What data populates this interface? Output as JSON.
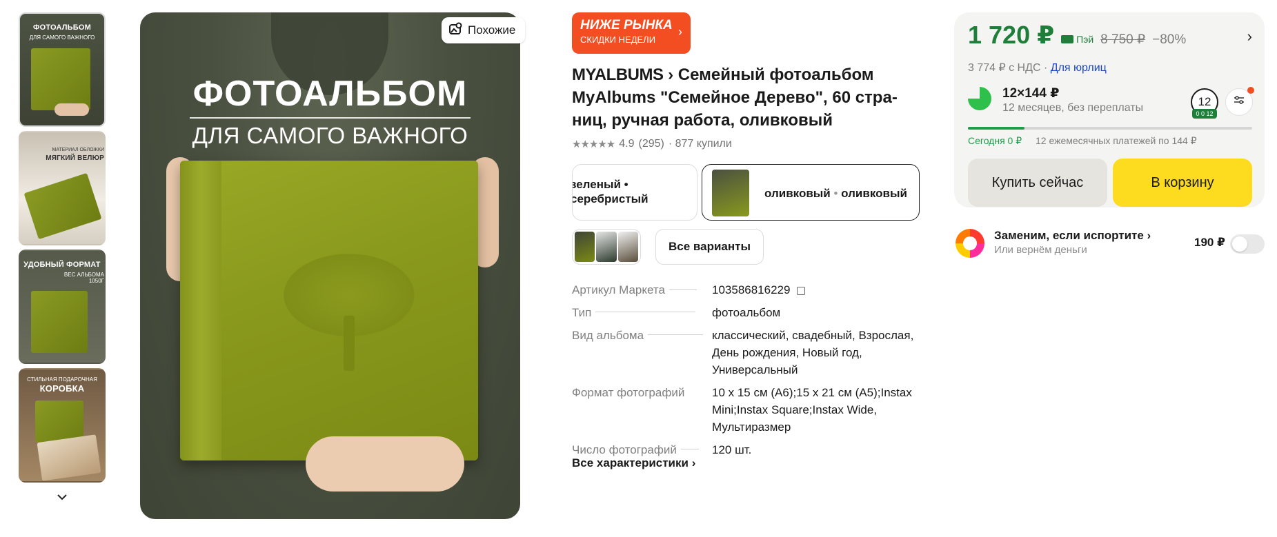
{
  "thumbnails": [
    {
      "title": "ФОТОАЛЬБОМ",
      "subtitle": "ДЛЯ САМОГО ВАЖНОГО"
    },
    {
      "title": "МЯГКИЙ ВЕЛЮР",
      "subtitle": "МАТЕРИАЛ ОБЛОЖКИ"
    },
    {
      "title": "УДОБНЫЙ ФОРМАТ",
      "subtitle": "ВЕС АЛЬБОМА 1050г"
    },
    {
      "title": "КОРОБКА",
      "subtitle": "СТИЛЬНАЯ ПОДАРОЧНАЯ"
    }
  ],
  "main_image": {
    "title": "ФОТОАЛЬБОМ",
    "subtitle": "ДЛЯ САМОГО ВАЖНОГО"
  },
  "similar_button": "Похожие",
  "promo": {
    "line1": "НИЖЕ РЫНКА",
    "line2": "СКИДКИ НЕДЕЛИ"
  },
  "product": {
    "brand": "MYALBUMS",
    "title": "Семейный фотоальбом MyAlbums \"Семейное Дерево\", 60 стра-ниц, ручная работа, оливковый",
    "rating": "4.9",
    "reviews": "(295)",
    "bought": "· 877 купили"
  },
  "variants": {
    "v1": "зеленый • серебристый",
    "v2_color": "оливковый",
    "v2_color2": "оливковый",
    "all_variants": "Все варианты"
  },
  "specs": [
    {
      "key": "Артикул Маркета",
      "value": "103586816229"
    },
    {
      "key": "Тип",
      "value": "фотоальбом"
    },
    {
      "key": "Вид альбома",
      "value": "классический, свадебный, Взрослая, День рождения, Новый год, Универсальный"
    },
    {
      "key": "Формат фотографий",
      "value": "10 x 15 см (А6);15 x 21 см (А5);Instax Mini;Instax Square;Instax Wide, Мультиразмер"
    },
    {
      "key": "Число фотографий",
      "value": "120 шт."
    }
  ],
  "all_characteristics": "Все характеристики",
  "buy_card": {
    "price": "1 720 ₽",
    "pay_label": "Пэй",
    "old_price": "8 750 ₽",
    "discount": "−80%",
    "nds_text": "3 774 ₽ с НДС ·",
    "legal_link": "Для юрлиц",
    "split_main": "12×144 ₽",
    "split_sub": "12 месяцев, без переплаты",
    "months": "12",
    "months_tag": "0 0 12",
    "progress": 0.2,
    "today": "Сегодня 0 ₽",
    "monthly": "12 ежемесячных платежей по 144 ₽",
    "buy_now": "Купить сейчас",
    "to_cart": "В корзину"
  },
  "insurance": {
    "title": "Заменим, если испортите",
    "subtitle": "Или вернём деньги",
    "price": "190 ₽"
  },
  "colors": {
    "accent_green": "#1e7e3a",
    "promo_orange": "#f24e22",
    "cart_yellow": "#fddb1e"
  }
}
